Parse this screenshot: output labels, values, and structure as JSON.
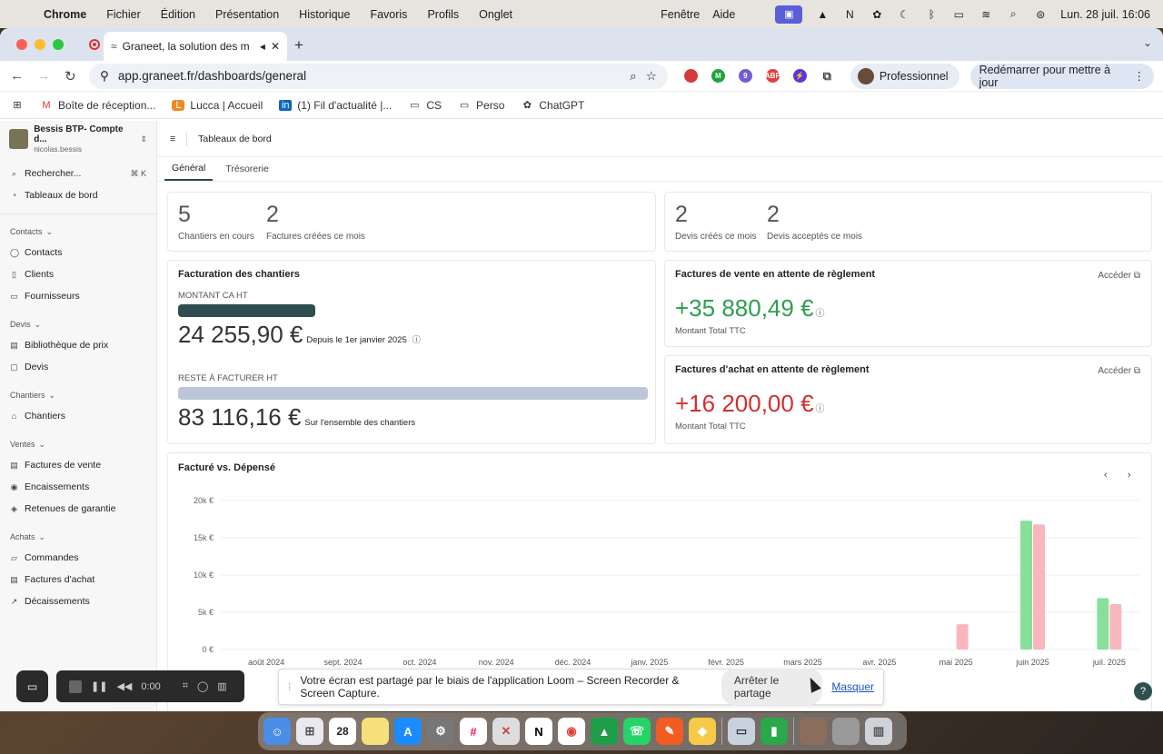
{
  "menubar": {
    "app": "Chrome",
    "items": [
      "Fichier",
      "Édition",
      "Présentation",
      "Historique",
      "Favoris",
      "Profils",
      "Onglet"
    ],
    "right_items": [
      "Fenêtre",
      "Aide"
    ],
    "datetime": "Lun. 28 juil.  16:06"
  },
  "browser": {
    "tab_title": "Graneet, la solution des m",
    "url": "app.graneet.fr/dashboards/general",
    "profile": "Professionnel",
    "update": "Redémarrer pour mettre à jour",
    "bookmarks": [
      "Boîte de réception...",
      "Lucca | Accueil",
      "(1) Fil d'actualité |...",
      "CS",
      "Perso",
      "ChatGPT"
    ]
  },
  "sidebar": {
    "company_name": "Bessis BTP- Compte d...",
    "user": "nicolas.bessis",
    "search": "Rechercher...",
    "search_kbd": "⌘ K",
    "dashboards": "Tableaux de bord",
    "sections": [
      {
        "title": "Contacts",
        "items": [
          "Contacts",
          "Clients",
          "Fournisseurs"
        ]
      },
      {
        "title": "Devis",
        "items": [
          "Bibliothèque de prix",
          "Devis"
        ]
      },
      {
        "title": "Chantiers",
        "items": [
          "Chantiers"
        ]
      },
      {
        "title": "Ventes",
        "items": [
          "Factures de vente",
          "Encaissements",
          "Retenues de garantie"
        ]
      },
      {
        "title": "Achats",
        "items": [
          "Commandes",
          "Factures d'achat",
          "Décaissements"
        ]
      }
    ]
  },
  "main": {
    "header": "Tableaux de bord",
    "tabs": [
      "Général",
      "Trésorerie"
    ],
    "stats_left": [
      {
        "value": "5",
        "label": "Chantiers en cours"
      },
      {
        "value": "2",
        "label": "Factures créées ce mois"
      }
    ],
    "stats_right": [
      {
        "value": "2",
        "label": "Devis créés ce mois"
      },
      {
        "value": "2",
        "label": "Devis acceptés ce mois"
      }
    ],
    "billing": {
      "title": "Facturation des chantiers",
      "ca_label": "MONTANT CA HT",
      "ca_value": "24 255,90 €",
      "ca_suffix": "Depuis le 1er janvier 2025",
      "reste_label": "RESTE À FACTURER HT",
      "reste_value": "83 116,16 €",
      "reste_suffix": "Sur l'ensemble des chantiers"
    },
    "sales_pending": {
      "title": "Factures de vente en attente de règlement",
      "link": "Accéder",
      "amount": "+35 880,49 €",
      "sub": "Montant Total TTC"
    },
    "purchase_pending": {
      "title": "Factures d'achat en attente de règlement",
      "link": "Accéder",
      "amount": "+16 200,00 €",
      "sub": "Montant Total TTC"
    }
  },
  "colors": {
    "green": "#2e9e4f",
    "red": "#d22f2f",
    "bar_dark": "#2f4e4f",
    "bar_light": "#bcc6d6",
    "chart_green": "#86e09c",
    "chart_pink": "#f7b7bd"
  },
  "chart_data": {
    "type": "bar",
    "title": "Facturé vs. Dépensé",
    "categories": [
      "août 2024",
      "sept. 2024",
      "oct. 2024",
      "nov. 2024",
      "déc. 2024",
      "janv. 2025",
      "févr. 2025",
      "mars 2025",
      "avr. 2025",
      "mai 2025",
      "juin 2025",
      "juil. 2025"
    ],
    "series": [
      {
        "values": [
          0,
          0,
          0,
          0,
          0,
          0,
          0,
          0,
          0,
          0,
          17300,
          6900
        ],
        "color": "#86e09c"
      },
      {
        "values": [
          0,
          0,
          0,
          0,
          0,
          0,
          0,
          0,
          0,
          3400,
          16800,
          6100
        ],
        "color": "#f7b7bd"
      }
    ],
    "yticks": [
      "0 €",
      "5k €",
      "10k €",
      "15k €",
      "20k €"
    ],
    "ylim": [
      0,
      20000
    ]
  },
  "loom": {
    "time": "0:00"
  },
  "share": {
    "text": "Votre écran est partagé par le biais de l'application Loom – Screen Recorder & Screen Capture.",
    "stop": "Arrêter le partage",
    "hide": "Masquer"
  },
  "help": "?"
}
